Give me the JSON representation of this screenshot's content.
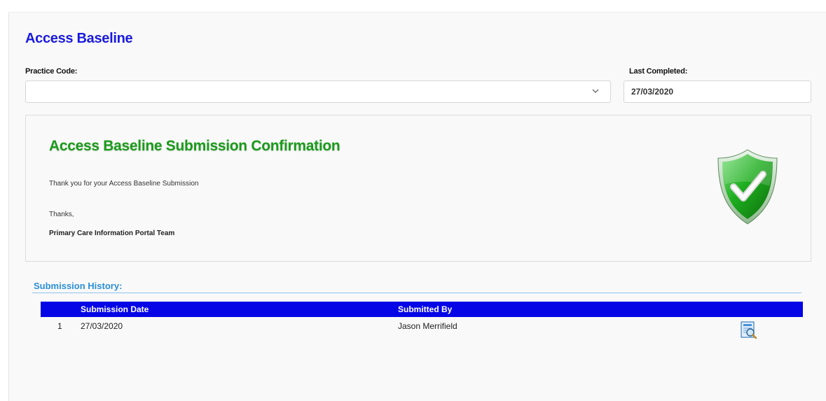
{
  "page": {
    "title": "Access Baseline"
  },
  "form": {
    "practice_code_label": "Practice Code:",
    "practice_code_value": "",
    "last_completed_label": "Last Completed:",
    "last_completed_value": "27/03/2020"
  },
  "confirmation": {
    "title": "Access Baseline Submission Confirmation",
    "message": "Thank you for your Access Baseline Submission",
    "thanks": "Thanks,",
    "team": "Primary Care Information Portal Team",
    "badge_icon": "shield-check-icon",
    "accent_color": "#1c9a1c"
  },
  "history": {
    "title": "Submission History:",
    "columns": [
      "",
      "Submission Date",
      "Submitted By",
      ""
    ],
    "rows": [
      {
        "index": "1",
        "date": "27/03/2020",
        "submitted_by": "Jason Merrifield",
        "action_icon": "view-document-icon"
      }
    ],
    "header_color": "#0505e6"
  },
  "colors": {
    "title": "#1a1adf",
    "history_title": "#2a8fd6"
  }
}
